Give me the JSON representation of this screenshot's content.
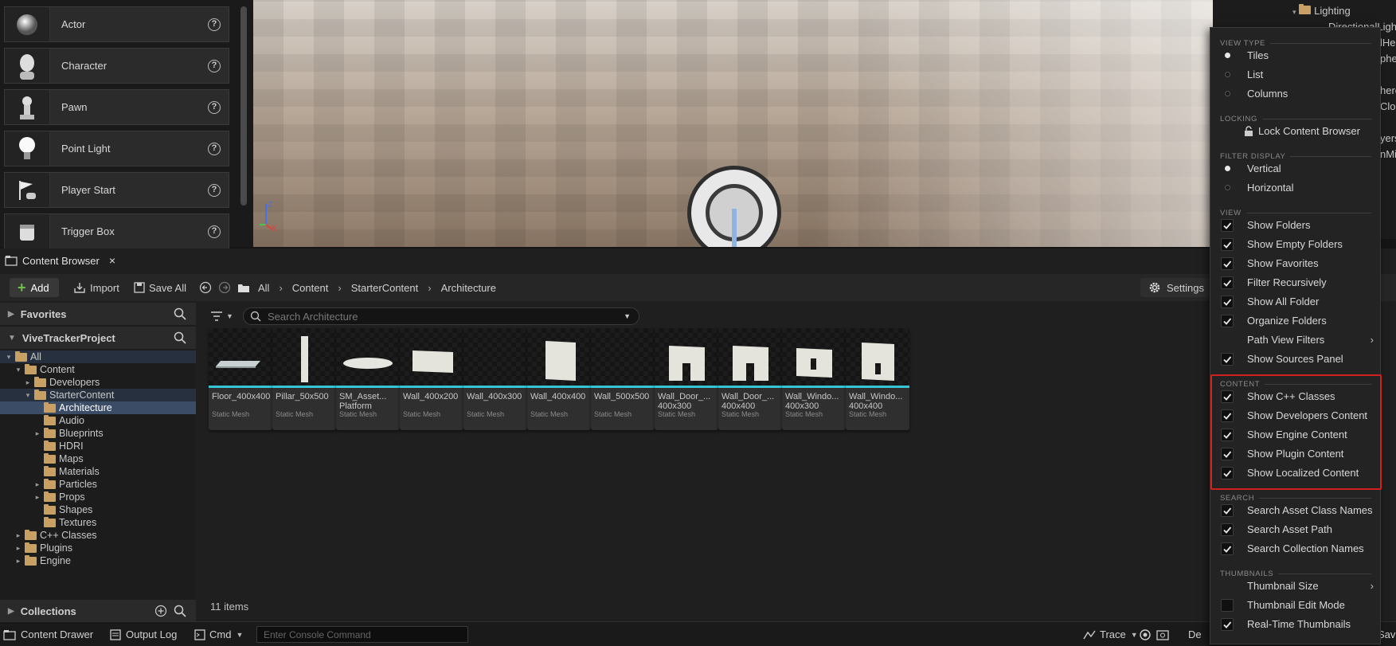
{
  "place_actors": {
    "items": [
      {
        "label": "Actor",
        "icon": "sphere-icon"
      },
      {
        "label": "Character",
        "icon": "character-icon"
      },
      {
        "label": "Pawn",
        "icon": "pawn-icon"
      },
      {
        "label": "Point Light",
        "icon": "lightbulb-icon"
      },
      {
        "label": "Player Start",
        "icon": "flag-icon"
      },
      {
        "label": "Trigger Box",
        "icon": "box-icon"
      }
    ],
    "help_glyph": "?"
  },
  "viewport": {
    "axis": {
      "z": "Z",
      "x": "X"
    }
  },
  "outliner": {
    "lighting_label": "Lighting",
    "directional_fragment": "DirectionalLigh",
    "fragments": [
      "lHei",
      "pher",
      "here",
      "Clou",
      "yers",
      "nMi"
    ]
  },
  "content_browser": {
    "tab_label": "Content Browser",
    "close_glyph": "×",
    "toolbar": {
      "add_label": "Add",
      "import_label": "Import",
      "save_all_label": "Save All",
      "breadcrumb": [
        "All",
        "Content",
        "StarterContent",
        "Architecture"
      ],
      "settings_label": "Settings"
    },
    "favorites_label": "Favorites",
    "project_label": "ViveTrackerProject",
    "collections_label": "Collections",
    "tree": [
      {
        "label": "All",
        "depth": 0,
        "expander": "▾",
        "state": "hl"
      },
      {
        "label": "Content",
        "depth": 1,
        "expander": "▾",
        "state": ""
      },
      {
        "label": "Developers",
        "depth": 2,
        "expander": "▸",
        "state": ""
      },
      {
        "label": "StarterContent",
        "depth": 2,
        "expander": "▾",
        "state": "hl"
      },
      {
        "label": "Architecture",
        "depth": 3,
        "expander": "",
        "state": "sel"
      },
      {
        "label": "Audio",
        "depth": 3,
        "expander": "",
        "state": ""
      },
      {
        "label": "Blueprints",
        "depth": 3,
        "expander": "▸",
        "state": ""
      },
      {
        "label": "HDRI",
        "depth": 3,
        "expander": "",
        "state": ""
      },
      {
        "label": "Maps",
        "depth": 3,
        "expander": "",
        "state": ""
      },
      {
        "label": "Materials",
        "depth": 3,
        "expander": "",
        "state": ""
      },
      {
        "label": "Particles",
        "depth": 3,
        "expander": "▸",
        "state": ""
      },
      {
        "label": "Props",
        "depth": 3,
        "expander": "▸",
        "state": ""
      },
      {
        "label": "Shapes",
        "depth": 3,
        "expander": "",
        "state": ""
      },
      {
        "label": "Textures",
        "depth": 3,
        "expander": "",
        "state": ""
      },
      {
        "label": "C++ Classes",
        "depth": 1,
        "expander": "▸",
        "state": ""
      },
      {
        "label": "Plugins",
        "depth": 1,
        "expander": "▸",
        "state": ""
      },
      {
        "label": "Engine",
        "depth": 1,
        "expander": "▸",
        "state": ""
      }
    ],
    "search_placeholder": "Search Architecture",
    "assets": [
      {
        "name": "Floor_400x400",
        "type": "Static Mesh",
        "shape": "floor"
      },
      {
        "name": "Pillar_50x500",
        "type": "Static Mesh",
        "shape": "pillar"
      },
      {
        "name": "SM_Asset...\nPlatform",
        "type": "Static Mesh",
        "shape": "platform"
      },
      {
        "name": "Wall_400x200",
        "type": "Static Mesh",
        "shape": "wall-short"
      },
      {
        "name": "Wall_400x300",
        "type": "Static Mesh",
        "shape": "none"
      },
      {
        "name": "Wall_400x400",
        "type": "Static Mesh",
        "shape": "wall-square"
      },
      {
        "name": "Wall_500x500",
        "type": "Static Mesh",
        "shape": "none"
      },
      {
        "name": "Wall_Door_...\n400x300",
        "type": "Static Mesh",
        "shape": "door"
      },
      {
        "name": "Wall_Door_...\n400x400",
        "type": "Static Mesh",
        "shape": "door"
      },
      {
        "name": "Wall_Windo...\n400x300",
        "type": "Static Mesh",
        "shape": "window"
      },
      {
        "name": "Wall_Windo...\n400x400",
        "type": "Static Mesh",
        "shape": "window-tall"
      }
    ],
    "item_count": "11 items"
  },
  "status_bar": {
    "content_drawer": "Content Drawer",
    "output_log": "Output Log",
    "cmd": "Cmd",
    "console_placeholder": "Enter Console Command",
    "trace": "Trace",
    "derived_fragment": "De",
    "save_fragment": "Sav"
  },
  "settings_menu": {
    "sections": {
      "view_type": "VIEW TYPE",
      "locking": "LOCKING",
      "filter_display": "FILTER DISPLAY",
      "view": "VIEW",
      "content": "CONTENT",
      "search": "SEARCH",
      "thumbnails": "THUMBNAILS"
    },
    "items": [
      {
        "label": "Tiles",
        "kind": "radio",
        "on": true
      },
      {
        "label": "List",
        "kind": "radio",
        "on": false
      },
      {
        "label": "Columns",
        "kind": "radio",
        "on": false
      },
      {
        "label": "Lock Content Browser",
        "kind": "lock"
      },
      {
        "label": "Vertical",
        "kind": "radio",
        "on": true
      },
      {
        "label": "Horizontal",
        "kind": "radio",
        "on": false
      },
      {
        "label": "Show Folders",
        "kind": "check",
        "on": true
      },
      {
        "label": "Show Empty Folders",
        "kind": "check",
        "on": true
      },
      {
        "label": "Show Favorites",
        "kind": "check",
        "on": true
      },
      {
        "label": "Filter Recursively",
        "kind": "check",
        "on": true
      },
      {
        "label": "Show All Folder",
        "kind": "check",
        "on": true
      },
      {
        "label": "Organize Folders",
        "kind": "check",
        "on": true
      },
      {
        "label": "Path View Filters",
        "kind": "submenu"
      },
      {
        "label": "Show Sources Panel",
        "kind": "check",
        "on": true
      },
      {
        "label": "Show C++ Classes",
        "kind": "check",
        "on": true
      },
      {
        "label": "Show Developers Content",
        "kind": "check",
        "on": true
      },
      {
        "label": "Show Engine Content",
        "kind": "check",
        "on": true
      },
      {
        "label": "Show Plugin Content",
        "kind": "check",
        "on": true
      },
      {
        "label": "Show Localized Content",
        "kind": "check",
        "on": true
      },
      {
        "label": "Search Asset Class Names",
        "kind": "check",
        "on": true
      },
      {
        "label": "Search Asset Path",
        "kind": "check",
        "on": true
      },
      {
        "label": "Search Collection Names",
        "kind": "check",
        "on": true
      },
      {
        "label": "Thumbnail Size",
        "kind": "submenu"
      },
      {
        "label": "Thumbnail Edit Mode",
        "kind": "check",
        "on": false
      },
      {
        "label": "Real-Time Thumbnails",
        "kind": "check",
        "on": true
      }
    ],
    "submenu_glyph": "›",
    "check_glyph": "✓"
  },
  "colors": {
    "highlight_box": "#d02020",
    "asset_underline": "#34c4d6",
    "selection": "#3b4c66",
    "add_plus": "#6cc24a"
  }
}
